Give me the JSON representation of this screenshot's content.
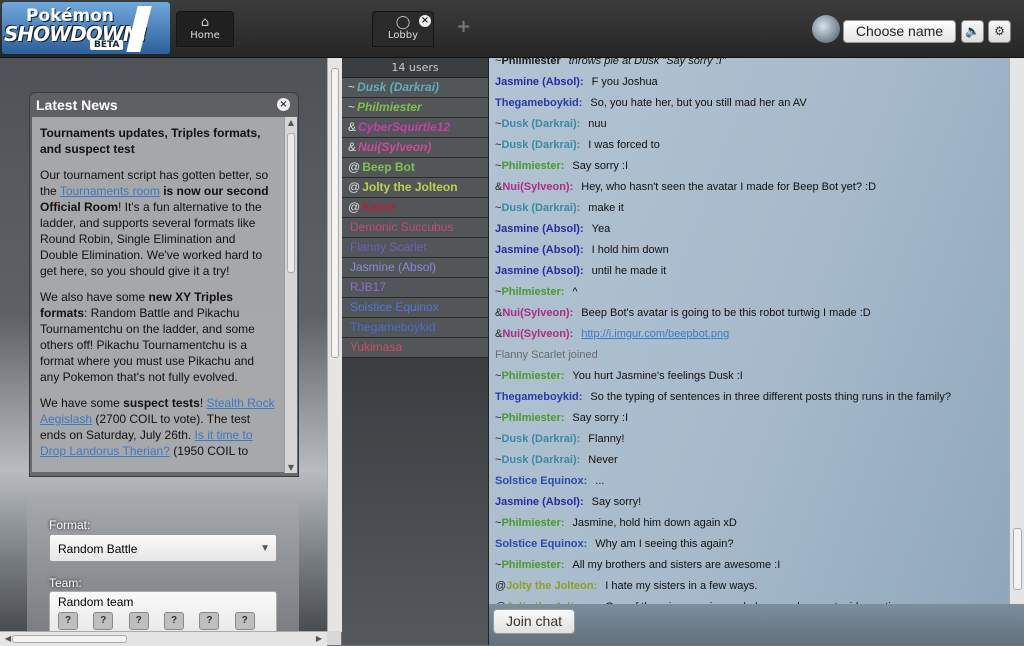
{
  "header": {
    "logo": {
      "line1": "Pokémon",
      "line2": "SHOWDOWN!",
      "badge": "BETA"
    },
    "home_tab_label": "Home",
    "lobby_tab_label": "Lobby",
    "add_tab_label": "+",
    "choose_name_label": "Choose name",
    "sound_icon": "speaker-icon",
    "options_icon": "gear-icon"
  },
  "news": {
    "title": "Latest News",
    "heading": "Tournaments updates, Triples formats, and suspect test",
    "p1_a": "Our tournament script has gotten better, so the ",
    "p1_link": "Tournaments room",
    "p1_b": " is now our second Official Room",
    "p1_c": "! It's a fun alternative to the ladder, and supports several formats like Round Robin, Single Elimination and Double Elimination. We've worked hard to get here, so you should give it a try!",
    "p2_a": "We also have some ",
    "p2_b": "new XY Triples formats",
    "p2_c": ": Random Battle and Pikachu Tournamentchu on the ladder, and some others off! Pikachu Tournamentchu is a format where you must use Pikachu and any Pokemon that's not fully evolved.",
    "p3_a": "We have some ",
    "p3_b": "suspect tests",
    "p3_c": "! ",
    "p3_link1": "Stealth Rock Aegislash",
    "p3_d": " (2700 COIL to vote). The test ends on Saturday, July 26th. ",
    "p3_link2": "Is it time to Drop Landorus Therian?",
    "p3_e": " (1950 COIL to"
  },
  "form": {
    "format_label": "Format:",
    "format_value": "Random Battle",
    "team_label": "Team:",
    "team_value": "Random team"
  },
  "users": {
    "count_label": "14 users",
    "list": [
      {
        "sym": "~",
        "name": "Dusk (Darkrai)",
        "color": "#5fb0b8",
        "style": "bi"
      },
      {
        "sym": "~",
        "name": "Philmiester",
        "color": "#7fbf4a",
        "style": "bi"
      },
      {
        "sym": "&",
        "name": "CyberSquirtle12",
        "color": "#c43fa8",
        "style": "bi"
      },
      {
        "sym": "&",
        "name": "Nui(Sylveon)",
        "color": "#d04a9a",
        "style": "bi"
      },
      {
        "sym": "@",
        "name": "Beep Bot",
        "color": "#7ec34a",
        "style": "b"
      },
      {
        "sym": "@",
        "name": "Jolty the Jolteon",
        "color": "#b9d34a",
        "style": "b"
      },
      {
        "sym": "@",
        "name": "Katee",
        "color": "#b1233a",
        "style": "b"
      },
      {
        "sym": "",
        "name": "Demonic Succubus",
        "color": "#c44a78",
        "style": ""
      },
      {
        "sym": "",
        "name": "Flanny Scarlet",
        "color": "#6a5fc8",
        "style": ""
      },
      {
        "sym": "",
        "name": "Jasmine (Absol)",
        "color": "#8a8ad8",
        "style": ""
      },
      {
        "sym": "",
        "name": "RJB17",
        "color": "#8a6fd0",
        "style": ""
      },
      {
        "sym": "",
        "name": "Solstice Equinox",
        "color": "#4a7ad8",
        "style": ""
      },
      {
        "sym": "",
        "name": "Thegameboykid",
        "color": "#4a6ad0",
        "style": ""
      },
      {
        "sym": "",
        "name": "Yukimasa",
        "color": "#d04a6a",
        "style": ""
      }
    ]
  },
  "chat": {
    "messages": [
      {
        "sym": "~",
        "user": "Philmiester",
        "color": "#1a1a1a",
        "text": "throws pie at Dusk \"Say sorry :I\"",
        "first": true
      },
      {
        "sym": "",
        "user": "Jasmine (Absol):",
        "color": "#2a2aa0",
        "text": "F you Joshua"
      },
      {
        "sym": "",
        "user": "Thegameboykid:",
        "color": "#2a3aa8",
        "text": "So, you hate her, but you still mad her an AV"
      },
      {
        "sym": "~",
        "user": "Dusk (Darkrai):",
        "color": "#3a8aa0",
        "text": "nuu"
      },
      {
        "sym": "~",
        "user": "Dusk (Darkrai):",
        "color": "#3a8aa0",
        "text": "I was forced to"
      },
      {
        "sym": "~",
        "user": "Philmiester:",
        "color": "#4a9a2a",
        "text": "Say sorry :I"
      },
      {
        "sym": "&",
        "user": "Nui(Sylveon):",
        "color": "#b02a80",
        "text": "Hey, who hasn't seen the avatar I made for Beep Bot yet? :D"
      },
      {
        "sym": "~",
        "user": "Dusk (Darkrai):",
        "color": "#3a8aa0",
        "text": "make it"
      },
      {
        "sym": "",
        "user": "Jasmine (Absol):",
        "color": "#2a2aa0",
        "text": "Yea"
      },
      {
        "sym": "",
        "user": "Jasmine (Absol):",
        "color": "#2a2aa0",
        "text": "I hold him down"
      },
      {
        "sym": "",
        "user": "Jasmine (Absol):",
        "color": "#2a2aa0",
        "text": "until he made it"
      },
      {
        "sym": "~",
        "user": "Philmiester:",
        "color": "#4a9a2a",
        "text": "^"
      },
      {
        "sym": "&",
        "user": "Nui(Sylveon):",
        "color": "#b02a80",
        "text": "Beep Bot's avatar is going to be this robot turtwig I made :D"
      },
      {
        "sym": "&",
        "user": "Nui(Sylveon):",
        "color": "#b02a80",
        "text": "",
        "link": "http://i.imgur.com/beepbot.png"
      },
      {
        "notice": "Flanny Scarlet joined"
      },
      {
        "sym": "~",
        "user": "Philmiester:",
        "color": "#4a9a2a",
        "text": "You hurt Jasmine's feelings Dusk :I"
      },
      {
        "sym": "",
        "user": "Thegameboykid:",
        "color": "#2a3aa8",
        "text": "So the typing of sentences in three different posts thing runs in the family?"
      },
      {
        "sym": "~",
        "user": "Philmiester:",
        "color": "#4a9a2a",
        "text": "Say sorry :I"
      },
      {
        "sym": "~",
        "user": "Dusk (Darkrai):",
        "color": "#3a8aa0",
        "text": "Flanny!"
      },
      {
        "sym": "~",
        "user": "Dusk (Darkrai):",
        "color": "#3a8aa0",
        "text": "Never"
      },
      {
        "sym": "",
        "user": "Solstice Equinox:",
        "color": "#2a4ab0",
        "text": "..."
      },
      {
        "sym": "",
        "user": "Jasmine (Absol):",
        "color": "#2a2aa0",
        "text": "Say sorry!"
      },
      {
        "sym": "~",
        "user": "Philmiester:",
        "color": "#4a9a2a",
        "text": "Jasmine, hold him down again xD"
      },
      {
        "sym": "",
        "user": "Solstice Equinox:",
        "color": "#2a4ab0",
        "text": "Why am I seeing this again?"
      },
      {
        "sym": "~",
        "user": "Philmiester:",
        "color": "#4a9a2a",
        "text": "All my brothers and sisters are awesome :I"
      },
      {
        "sym": "@",
        "user": "Jolty the Jolteon:",
        "color": "#8aa020",
        "text": "I hate my sisters in a few ways."
      },
      {
        "sym": "@",
        "user": "Jolty the Jolteon:",
        "color": "#8aa020",
        "text": "One of them is annoying and always asks my stupid questions"
      }
    ],
    "join_label": "Join chat"
  }
}
